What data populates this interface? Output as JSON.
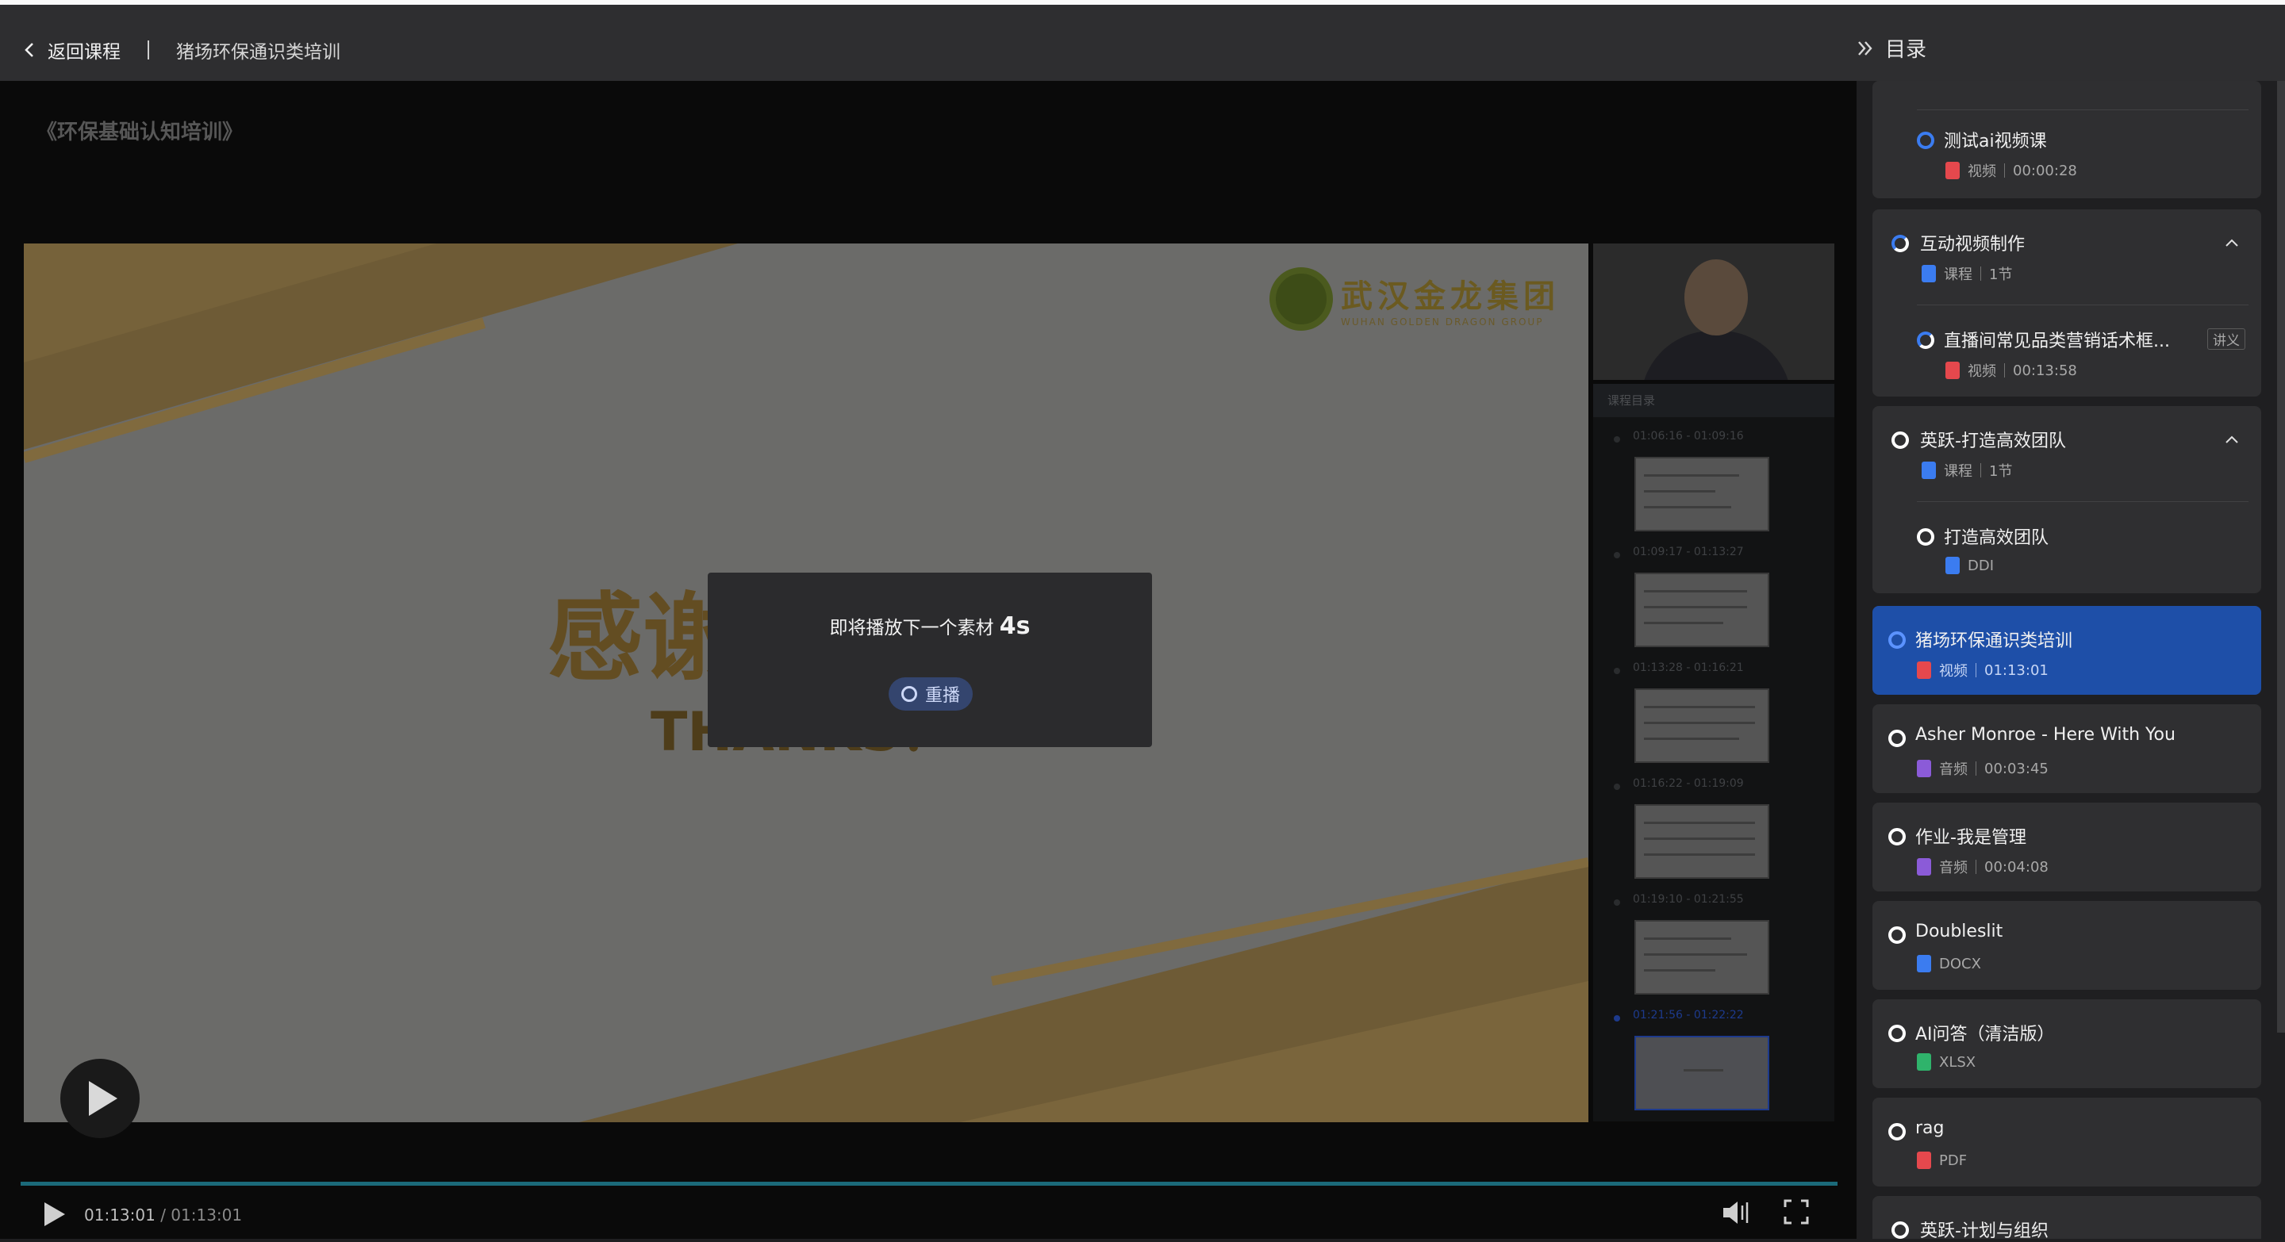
{
  "topbar": {
    "back_label": "返回课程",
    "crumb": "猪场环保通识类培训",
    "toc_label": "目录"
  },
  "stage": {
    "course_title": "《环保基础认知培训》",
    "slide_company_cn": "武汉金龙集团",
    "slide_company_en": "WUHAN GOLDEN DRAGON GROUP",
    "slide_thanks_cn": "感谢观看！",
    "slide_thanks_en": "THANKS！",
    "side_toc_header": "课程目录",
    "thumbs": [
      {
        "time": "01:06:16 - 01:09:16"
      },
      {
        "time": "01:09:17 - 01:13:27"
      },
      {
        "time": "01:13:28 - 01:16:21"
      },
      {
        "time": "01:16:22 - 01:19:09"
      },
      {
        "time": "01:19:10 - 01:21:55"
      },
      {
        "time": "01:21:56 - 01:22:22"
      }
    ],
    "overlay": {
      "msg": "即将播放下一个素材",
      "countdown": "4s",
      "replay_label": "重播"
    },
    "player": {
      "current_time": "01:13:01",
      "total_time": "/ 01:13:01",
      "progress_fraction": 1.0
    }
  },
  "toc": {
    "items": [
      {
        "title": "测试ai视频课",
        "type": "视频",
        "duration": "00:00:28"
      },
      {
        "title": "互动视频制作",
        "type": "课程",
        "duration": "1节"
      },
      {
        "title": "直播间常见品类营销话术框...",
        "tag": "讲义",
        "type": "视频",
        "duration": "00:13:58"
      },
      {
        "title": "英跃-打造高效团队",
        "type": "课程",
        "duration": "1节"
      },
      {
        "title": "打造高效团队",
        "type": "DDI"
      },
      {
        "title": "猪场环保通识类培训",
        "type": "视频",
        "duration": "01:13:01"
      },
      {
        "title": "Asher Monroe - Here With You",
        "type": "音频",
        "duration": "00:03:45"
      },
      {
        "title": "作业-我是管理",
        "type": "音频",
        "duration": "00:04:08"
      },
      {
        "title": "Doubleslit",
        "type": "DOCX"
      },
      {
        "title": "AI问答（清洁版）",
        "type": "XLSX"
      },
      {
        "title": "rag",
        "type": "PDF"
      },
      {
        "title": "英跃-计划与组织"
      }
    ]
  },
  "colors": {
    "accent": "#1e4fa8",
    "card": "#2f2f31",
    "topbar": "#2e2e30"
  }
}
